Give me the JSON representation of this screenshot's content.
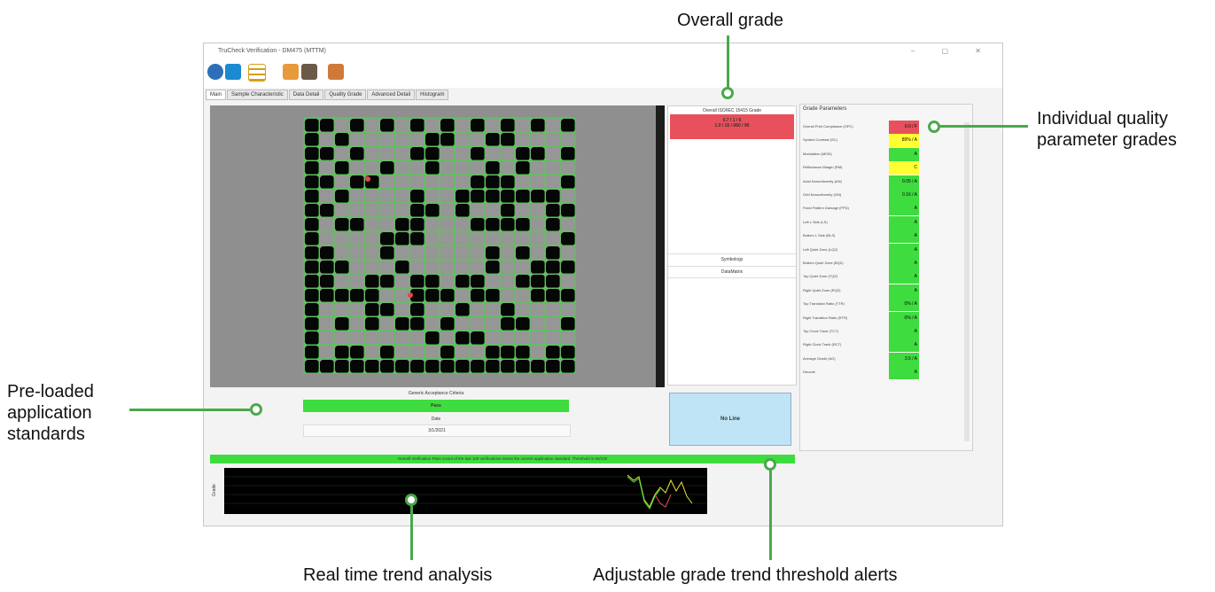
{
  "callouts": {
    "overall_grade": "Overall grade",
    "individual_line1": "Individual quality",
    "individual_line2": "parameter grades",
    "preloaded_line1": "Pre-loaded",
    "preloaded_line2": "application",
    "preloaded_line3": "standards",
    "realtime": "Real time trend analysis",
    "adjustable": "Adjustable grade trend threshold alerts"
  },
  "colors": {
    "accent": "#4aa94a",
    "fail": "#e8505b",
    "pass": "#3fdc3f",
    "warn": "#ffff33",
    "info": "#bfe4f6"
  },
  "window": {
    "title": "TruCheck Verification - DM475 (MTTM)",
    "tabs": [
      "Main",
      "Sample Characteristic",
      "Data Detail",
      "Quality Grade",
      "Advanced Detail",
      "Histogram"
    ],
    "toolbar_icons": [
      "settings-icon",
      "camera-icon",
      "grid-icon",
      "image-open-icon",
      "image-save-icon",
      "export-icon"
    ]
  },
  "grade_panel": {
    "title": "Overall ISO/IEC 15415 Grade",
    "line1": "0.7 / 1 / 6",
    "line2": "1.0 / 16 / 660 / 90",
    "mid1": "Symbology",
    "mid2": "DataMatrix",
    "no_line": "No Line"
  },
  "params": {
    "title": "Grade Parameters",
    "rows": [
      {
        "label": "Overall Print Compliance (OPC)",
        "grade": "0.0 / F",
        "color": "#e8505b"
      },
      {
        "label": "Symbol Contrast (SC)",
        "grade": "89% / A",
        "color": "#ffff33"
      },
      {
        "label": "Modulation (MOD)",
        "grade": "A",
        "color": "#3fdc3f"
      },
      {
        "label": "Reflectance Margin (RM)",
        "grade": "C",
        "color": "#ffff33"
      },
      {
        "label": "Axial Nonuniformity (AN)",
        "grade": "0.05 / A",
        "color": "#3fdc3f"
      },
      {
        "label": "Grid Nonuniformity (GN)",
        "grade": "0.16 / A",
        "color": "#3fdc3f"
      },
      {
        "label": "Fixed Pattern Damage (FPD)",
        "grade": "A",
        "color": "#3fdc3f"
      },
      {
        "label": "Left L Side (LS)",
        "grade": "A",
        "color": "#3fdc3f"
      },
      {
        "label": "Bottom L Side (BLS)",
        "grade": "A",
        "color": "#3fdc3f"
      },
      {
        "label": "Left Quiet Zone (LQZ)",
        "grade": "A",
        "color": "#3fdc3f"
      },
      {
        "label": "Bottom Quiet Zone (BQZ)",
        "grade": "A",
        "color": "#3fdc3f"
      },
      {
        "label": "Top Quiet Zone (TQZ)",
        "grade": "A",
        "color": "#3fdc3f"
      },
      {
        "label": "Right Quiet Zone (RQZ)",
        "grade": "A",
        "color": "#3fdc3f"
      },
      {
        "label": "Top Transition Ratio (TTR)",
        "grade": "0% / A",
        "color": "#3fdc3f"
      },
      {
        "label": "Right Transition Ratio (RTR)",
        "grade": "0% / A",
        "color": "#3fdc3f"
      },
      {
        "label": "Top Clock Track (TCT)",
        "grade": "A",
        "color": "#3fdc3f"
      },
      {
        "label": "Right Clock Track (RCT)",
        "grade": "A",
        "color": "#3fdc3f"
      },
      {
        "label": "Average Grade (AG)",
        "grade": "3.5 / A",
        "color": "#3fdc3f"
      },
      {
        "label": "Decode",
        "grade": "A",
        "color": "#3fdc3f"
      }
    ]
  },
  "criteria": {
    "title": "Generic Acceptance Criteria",
    "result": "Pass",
    "date_label": "Date",
    "date_value": "3/1/2021"
  },
  "alert_bar": "Overall Verification Pass Count of the last 100 verifications meets the current application standard. Threshold is 80/100",
  "trend": {
    "ylabel": "Grade"
  }
}
